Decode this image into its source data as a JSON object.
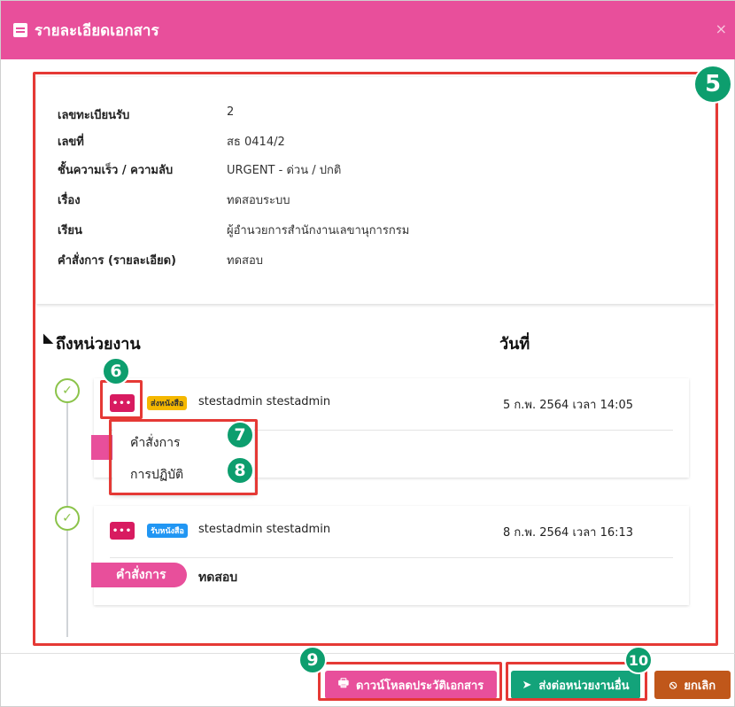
{
  "modal": {
    "title": "รายละเอียดเอกสาร",
    "close": "×"
  },
  "details": [
    {
      "label": "เลขทะเบียนรับ",
      "value": "2"
    },
    {
      "label": "เลขที่",
      "value": "สธ 0414/2"
    },
    {
      "label": "ชั้นความเร็ว / ความลับ",
      "value": "URGENT - ด่วน / ปกติ"
    },
    {
      "label": "เรื่อง",
      "value": "ทดสอบระบบ"
    },
    {
      "label": "เรียน",
      "value": "ผู้อำนวยการสำนักงานเลขานุการกรม"
    },
    {
      "label": "คำสั่งการ (รายละเอียด)",
      "value": "ทดสอบ"
    }
  ],
  "timeline": {
    "heading": "ถึงหน่วยงาน",
    "date_heading": "วันที่",
    "entries": [
      {
        "menu": "•••",
        "tag": "ส่งหนังสือ",
        "name": "stestadmin stestadmin",
        "date": "5 ก.พ. 2564 เวลา 14:05"
      },
      {
        "menu": "•••",
        "tag": "รับหนังสือ",
        "name": "stestadmin stestadmin",
        "date": "8 ก.พ. 2564 เวลา 16:13",
        "pill_label": "คำสั่งการ",
        "pill_value": "ทดสอบ"
      }
    ]
  },
  "dropdown": {
    "items": [
      "คำสั่งการ",
      "การปฏิบัติ"
    ]
  },
  "callouts": [
    "5",
    "6",
    "7",
    "8",
    "9",
    "10"
  ],
  "footer": {
    "download": "ดาวน์โหลดประวัติเอกสาร",
    "forward": "ส่งต่อหน่วยงานอื่น",
    "cancel": "ยกเลิก"
  },
  "colors": {
    "header": "#e84f9b",
    "highlight": "#e53935",
    "callout": "#0d9e6e",
    "forward": "#13a37a",
    "cancel": "#c0571a"
  }
}
